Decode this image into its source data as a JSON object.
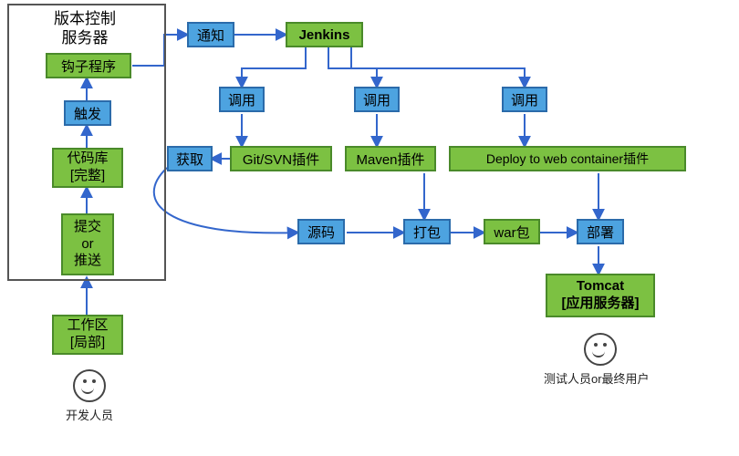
{
  "colors": {
    "blue": "#4DA3E0",
    "green": "#7CC142",
    "arrow": "#3366CC"
  },
  "frame": {
    "title_line1": "版本控制",
    "title_line2": "服务器"
  },
  "left_stack": {
    "hook": "钩子程序",
    "trigger": "触发",
    "repo": {
      "line1": "代码库",
      "line2": "[完整]"
    },
    "commit": {
      "line1": "提交",
      "line2": "or",
      "line3": "推送"
    },
    "workspace": {
      "line1": "工作区",
      "line2": "[局部]"
    }
  },
  "top_row": {
    "notify": "通知",
    "jenkins": "Jenkins"
  },
  "invoke": {
    "a": "调用",
    "b": "调用",
    "c": "调用"
  },
  "plugins": {
    "fetch": "获取",
    "gitsvn": "Git/SVN插件",
    "maven": "Maven插件",
    "deploy": "Deploy to web container插件"
  },
  "flow": {
    "source": "源码",
    "package": "打包",
    "war": "war包",
    "deploy": "部署"
  },
  "tomcat": {
    "line1": "Tomcat",
    "line2": "[应用服务器]"
  },
  "people": {
    "dev": "开发人员",
    "tester": "测试人员or最终用户"
  }
}
